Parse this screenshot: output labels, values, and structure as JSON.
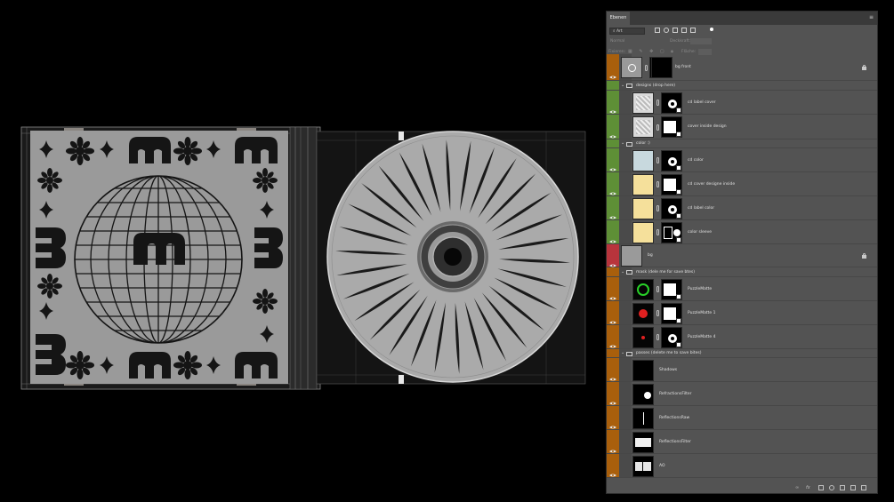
{
  "panel": {
    "tab_label": "Ebenen",
    "filter_label": "Art",
    "blend_mode": "Normal",
    "opacity_label": "Deckkraft:",
    "lock_label": "Fixieren:",
    "fill_label": "Fläche:"
  },
  "layers": [
    {
      "name": "bg front",
      "tag": "#a95f0c",
      "locked": true
    },
    {
      "name": "designs (drop here)",
      "tag": "#5e8f36",
      "group": true
    },
    {
      "name": "cd label cover",
      "tag": "#5e8f36"
    },
    {
      "name": "cover inside design",
      "tag": "#5e8f36"
    },
    {
      "name": "color :)",
      "tag": "#5e8f36",
      "group": true
    },
    {
      "name": "cd color",
      "tag": "#5e8f36"
    },
    {
      "name": "cd cover designe inside",
      "tag": "#5e8f36"
    },
    {
      "name": "cd label color",
      "tag": "#5e8f36"
    },
    {
      "name": "color sleeve",
      "tag": "#5e8f36"
    },
    {
      "name": "bg",
      "tag": "#b8343c",
      "locked": true
    },
    {
      "name": "mask (dele me for save btes)",
      "tag": "#a95f0c",
      "group": true
    },
    {
      "name": "PuzzleMatte",
      "tag": "#a95f0c"
    },
    {
      "name": "PuzzleMatte 1",
      "tag": "#a95f0c"
    },
    {
      "name": "PuzzleMatte 4",
      "tag": "#a95f0c"
    },
    {
      "name": "passes (delete me to save bites)",
      "tag": "#a95f0c",
      "group": true
    },
    {
      "name": "Shadows",
      "tag": "#a95f0c"
    },
    {
      "name": "RefractionsFilter",
      "tag": "#a95f0c"
    },
    {
      "name": "ReflectionsRaw",
      "tag": "#a95f0c"
    },
    {
      "name": "ReflectionsFilter",
      "tag": "#a95f0c"
    },
    {
      "name": "AO",
      "tag": "#a95f0c"
    }
  ]
}
